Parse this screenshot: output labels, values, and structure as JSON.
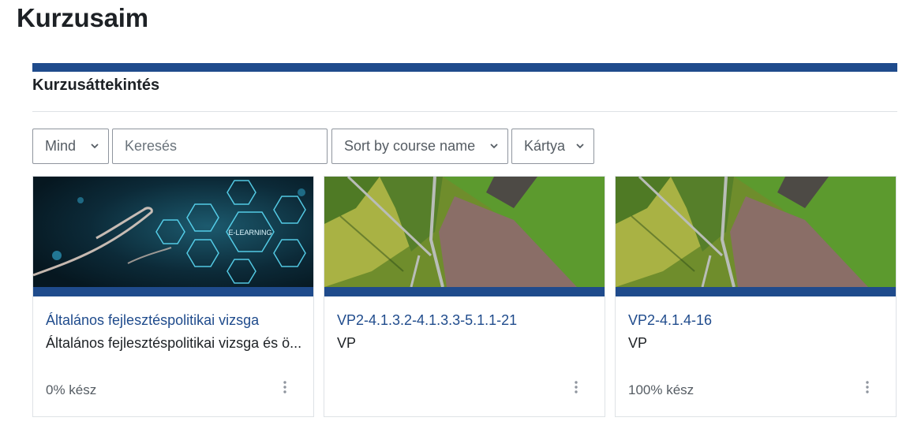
{
  "page": {
    "title": "Kurzusaim"
  },
  "overview": {
    "title": "Kurzusáttekintés",
    "filters": {
      "grouping": "Mind",
      "search_placeholder": "Keresés",
      "sort": "Sort by course name",
      "view": "Kártya"
    }
  },
  "courses": [
    {
      "name": "Általános fejlesztéspolitikai vizsga",
      "summary": "Általános fejlesztéspolitikai vizsga és ö...",
      "progress": "0% kész",
      "progress_value": 0,
      "image": "e-learning-banner"
    },
    {
      "name": "VP2-4.1.3.2-4.1.3.3-5.1.1-21",
      "summary": "VP",
      "progress": "",
      "progress_value": null,
      "image": "aerial-farmland"
    },
    {
      "name": "VP2-4.1.4-16",
      "summary": "VP",
      "progress": "100% kész",
      "progress_value": 100,
      "image": "aerial-farmland"
    }
  ],
  "image_label": "E-LEARNING",
  "colors": {
    "accent": "#1f4b8c",
    "link": "#1f4b8c",
    "text": "#1d2125",
    "muted": "#555c63",
    "border": "#dee2e6"
  }
}
